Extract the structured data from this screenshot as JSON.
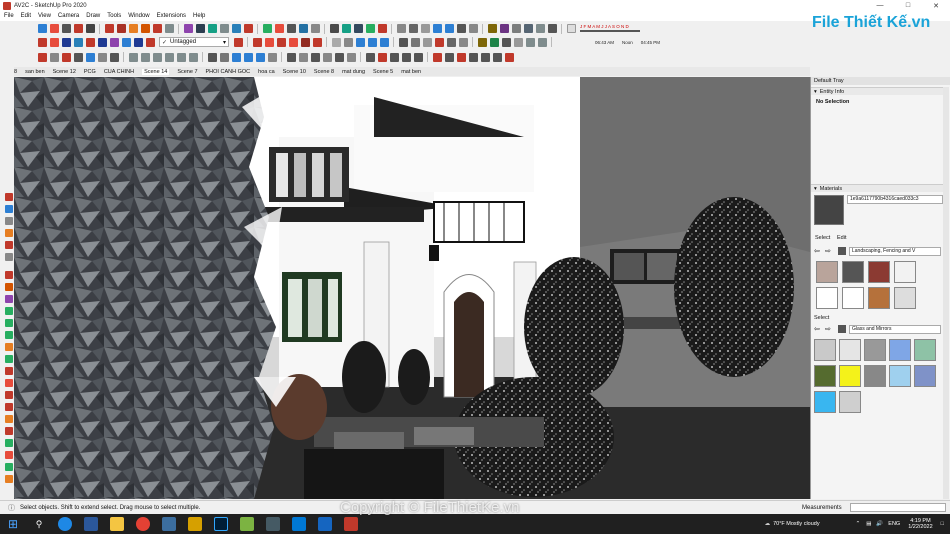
{
  "window": {
    "title": "AV2C - SketchUp Pro 2020"
  },
  "menu": [
    "File",
    "Edit",
    "View",
    "Camera",
    "Draw",
    "Tools",
    "Window",
    "Extensions",
    "Help"
  ],
  "toolbar": {
    "layer_select": "Untagged",
    "shadow_months": "J F M A M J J A S O N D",
    "shadow_time_start": "06:43 AM",
    "shadow_time_mid": "Noon",
    "shadow_time_end": "04:45 PM"
  },
  "scenes": {
    "prefix": "8",
    "tabs": [
      "san ben",
      "Scene 12",
      "PCG",
      "CUA CHINH",
      "Scene 14",
      "Scene 7",
      "PHOI CANH GOC",
      "hoa ca",
      "Scene 10",
      "Scene 8",
      "mat dung",
      "Scene 5",
      "mat ben"
    ],
    "active_index": 4
  },
  "tray": {
    "title": "Default Tray",
    "entity_info_label": "Entity Info",
    "entity_selection": "No Selection",
    "materials_label": "Materials",
    "material_name": "1e9a6117790b4316caed033c3",
    "tab_select": "Select",
    "tab_edit": "Edit",
    "library_1": "Landscaping, Fencing and V",
    "select_label_2": "Select",
    "library_2": "Glass and Mirrors"
  },
  "status": {
    "message": "Select objects. Shift to extend select. Drag mouse to select multiple.",
    "measurements_label": "Measurements"
  },
  "taskbar": {
    "weather": "70°F  Mostly cloudy",
    "lang": "ENG",
    "time": "4:19 PM",
    "date": "1/22/2022"
  },
  "overlay": {
    "watermark": "Copyright © FileThietKe.vn",
    "logo": "File Thiết Kế.vn"
  },
  "colors": {
    "accent_red": "#c0392b",
    "selection_blue": "#2d7fd3",
    "logo_blue": "#1aa3d8",
    "taskbar_bg": "#202020"
  }
}
